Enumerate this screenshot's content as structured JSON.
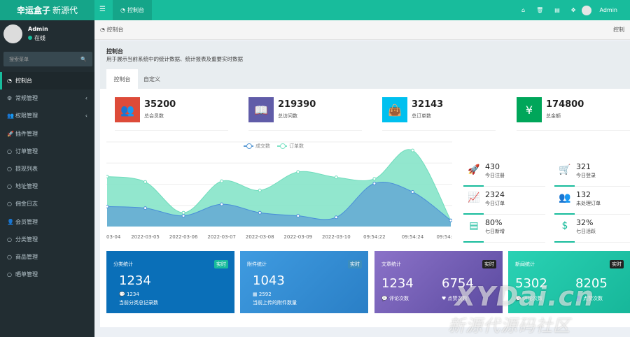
{
  "header": {
    "logo_bold": "幸运盒子",
    "logo_light": "新源代",
    "menu_icon": "hamburger-icon",
    "active_tab": "控制台",
    "right_icons": [
      "home-icon",
      "trash-icon",
      "language-icon",
      "fullscreen-icon"
    ],
    "user_name": "Admin"
  },
  "sidebar": {
    "user_name": "Admin",
    "status": "在线",
    "search_placeholder": "搜索菜单",
    "items": [
      {
        "label": "控制台",
        "icon": "dashboard-icon",
        "active": true
      },
      {
        "label": "常规管理",
        "icon": "cogs-icon",
        "chevron": true
      },
      {
        "label": "权限管理",
        "icon": "users-icon",
        "chevron": true
      },
      {
        "label": "插件管理",
        "icon": "rocket-icon"
      },
      {
        "label": "订单管理",
        "icon": "circle-icon"
      },
      {
        "label": "提现列表",
        "icon": "circle-icon"
      },
      {
        "label": "地址管理",
        "icon": "circle-icon"
      },
      {
        "label": "佣金日志",
        "icon": "circle-icon"
      },
      {
        "label": "会员管理",
        "icon": "user-icon"
      },
      {
        "label": "分类管理",
        "icon": "circle-icon"
      },
      {
        "label": "商品管理",
        "icon": "circle-icon"
      },
      {
        "label": "晒单管理",
        "icon": "circle-icon"
      }
    ]
  },
  "breadcrumb": {
    "left": "控制台",
    "right": "控制"
  },
  "panel": {
    "title": "控制台",
    "subtitle": "用于展示当前系统中的统计数据、统计报表及重要实时数据",
    "tabs": [
      "控制台",
      "自定义"
    ]
  },
  "stats": [
    {
      "value": "35200",
      "label": "总会员数",
      "color": "#dd4b39",
      "icon": "users-icon"
    },
    {
      "value": "219390",
      "label": "总访问数",
      "color": "#605ca8",
      "icon": "book-icon"
    },
    {
      "value": "32143",
      "label": "总订单数",
      "color": "#00c0ef",
      "icon": "shopping-bag-icon"
    },
    {
      "value": "174800",
      "label": "总金额",
      "color": "#00a65a",
      "icon": "yen-icon"
    }
  ],
  "mini_stats": [
    {
      "value": "430",
      "label": "今日注册",
      "icon": "rocket-icon"
    },
    {
      "value": "321",
      "label": "今日登录",
      "icon": "cart-icon"
    },
    {
      "value": "2324",
      "label": "今日订单",
      "icon": "line-chart-icon"
    },
    {
      "value": "132",
      "label": "未处理订单",
      "icon": "users-icon"
    },
    {
      "value": "80%",
      "label": "七日新增",
      "icon": "list-icon"
    },
    {
      "value": "32%",
      "label": "七日活跃",
      "icon": "dollar-icon"
    }
  ],
  "cards": [
    {
      "title": "分类统计",
      "badge": "实时",
      "num": "1234",
      "sub": "1234",
      "desc": "当前分类总记录数",
      "color": "#0073b7"
    },
    {
      "title": "附件统计",
      "badge": "实时",
      "num": "1043",
      "sub": "2592",
      "desc": "当前上传的附件数量",
      "color": "#3c8dbc"
    },
    {
      "title": "文章统计",
      "badge": "实时",
      "num1": "1234",
      "num2": "6754",
      "sub1": "评论次数",
      "sub2": "点赞次数",
      "color": "#605ca8"
    },
    {
      "title": "新闻统计",
      "badge": "实时",
      "num1": "5302",
      "num2": "8205",
      "sub1": "评论次数",
      "sub2": "点赞次数",
      "color": "#18bc9c"
    }
  ],
  "chart_data": {
    "type": "area",
    "x": [
      "03-04",
      "2022-03-05",
      "2022-03-06",
      "2022-03-07",
      "2022-03-08",
      "2022-03-09",
      "2022-03-10",
      "09:54:22",
      "09:54:24",
      "09:54:"
    ],
    "series": [
      {
        "name": "成交数",
        "values": [
          260,
          240,
          140,
          290,
          180,
          140,
          120,
          560,
          450,
          80
        ],
        "color": "#5b9bd5"
      },
      {
        "name": "订单数",
        "values": [
          650,
          580,
          180,
          590,
          470,
          710,
          640,
          620,
          990,
          80
        ],
        "color": "#7fe3c6"
      }
    ],
    "ylim": [
      0,
      1100
    ],
    "legend": "top-center"
  },
  "watermark": {
    "line1": "XYDai.cn",
    "line2": "新源代源码社区"
  }
}
